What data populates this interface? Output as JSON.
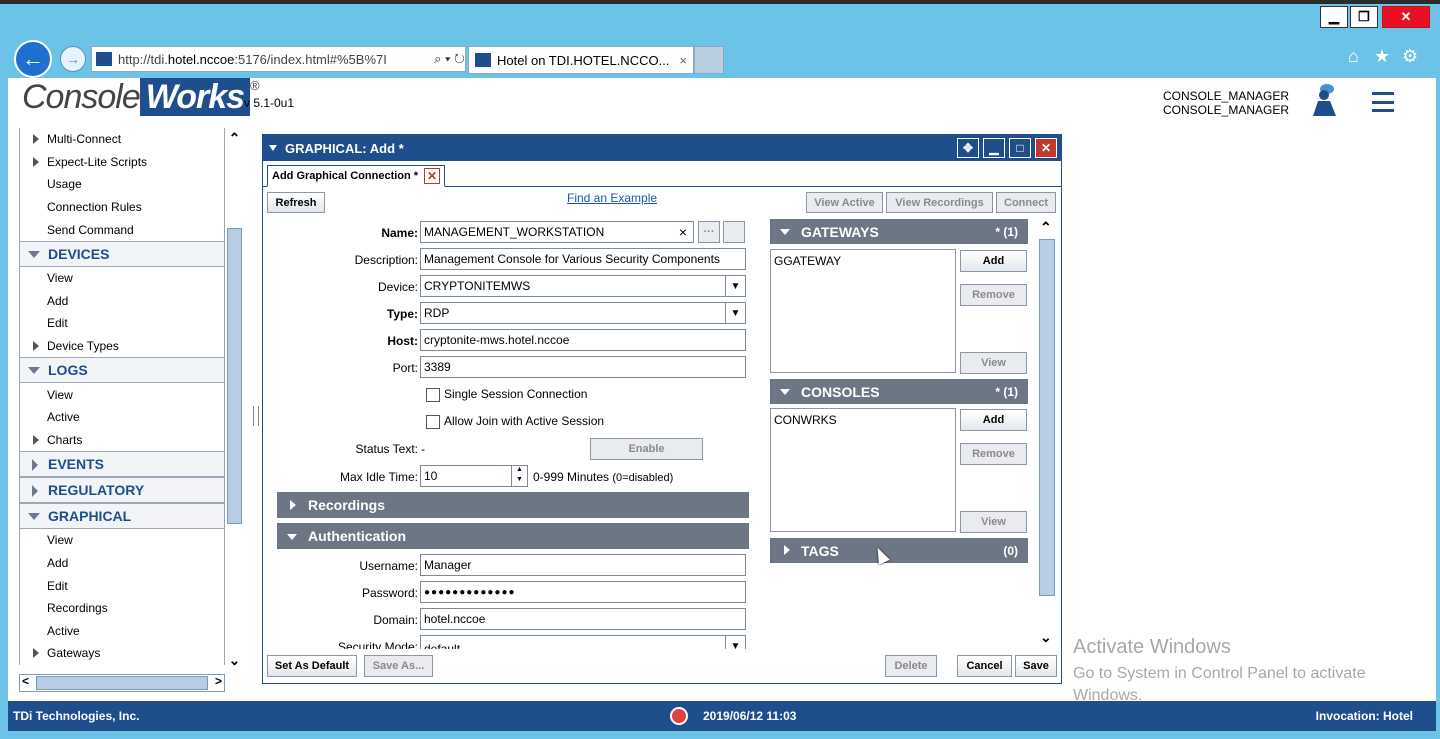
{
  "browser": {
    "url_pre": "http://tdi.",
    "url_host": "hotel.nccoe",
    "url_post": ":5176/index.html#%5B%7I",
    "url_controls": "⌕ ▾ ↻",
    "tab_title": "Hotel on TDI.HOTEL.NCCO...",
    "tab_close": "×",
    "min": "▁",
    "max": "❐",
    "close": "✕",
    "back": "←",
    "forward": "→",
    "home": "⌂",
    "star": "★",
    "gear": "⚙"
  },
  "app": {
    "logo_a": "Console",
    "logo_b": "Works",
    "logo_reg": "®",
    "version": "v 5.1-0u1",
    "user_line1": "CONSOLE_MANAGER",
    "user_line2": "CONSOLE_MANAGER"
  },
  "sidebar": {
    "top_items": [
      {
        "label": "Multi-Connect",
        "sub": true
      },
      {
        "label": "Expect-Lite Scripts",
        "sub": true
      },
      {
        "label": "Usage",
        "sub": false
      },
      {
        "label": "Connection Rules",
        "sub": false
      },
      {
        "label": "Send Command",
        "sub": false
      }
    ],
    "devices": {
      "title": "DEVICES",
      "items": [
        "View",
        "Add",
        "Edit"
      ],
      "sub_item": "Device Types"
    },
    "logs": {
      "title": "LOGS",
      "items": [
        "View",
        "Active"
      ],
      "sub_item": "Charts"
    },
    "events": "EVENTS",
    "regulatory": "REGULATORY",
    "graphical": {
      "title": "GRAPHICAL",
      "items": [
        "View",
        "Add",
        "Edit",
        "Recordings",
        "Active"
      ],
      "sub_item": "Gateways"
    },
    "scroll_up": "⌃",
    "scroll_down": "⌄",
    "hscroll_left": "<",
    "hscroll_right": ">"
  },
  "dialog": {
    "title": "GRAPHICAL: Add *",
    "ctl_move": "✥",
    "ctl_min": "▁",
    "ctl_max": "□",
    "ctl_close": "✕",
    "tab_label": "Add Graphical Connection *",
    "tab_close": "✕",
    "refresh": "Refresh",
    "find_example": "Find an Example",
    "view_active": "View Active",
    "view_recordings": "View Recordings",
    "connect": "Connect",
    "form": {
      "name_label": "Name:",
      "name_value": "MANAGEMENT_WORKSTATION",
      "name_clear": "×",
      "name_more": "···",
      "desc_label": "Description:",
      "desc_value": "Management Console for Various Security Components",
      "device_label": "Device:",
      "device_value": "CRYPTONITEMWS",
      "type_label": "Type:",
      "type_value": "RDP",
      "host_label": "Host:",
      "host_value": "cryptonite-mws.hotel.nccoe",
      "port_label": "Port:",
      "port_value": "3389",
      "single_session": "Single Session Connection",
      "allow_join": "Allow Join with Active Session",
      "status_label": "Status Text:",
      "status_value": "-",
      "enable": "Enable",
      "idle_label": "Max Idle Time:",
      "idle_value": "10",
      "idle_units": "0-999 Minutes",
      "idle_note": "(0=disabled)",
      "dropdown": "▼",
      "spin_up": "▲",
      "spin_down": "▼"
    },
    "recordings": "Recordings",
    "authentication": "Authentication",
    "auth": {
      "user_label": "Username:",
      "user_value": "Manager",
      "pass_label": "Password:",
      "pass_value": "●●●●●●●●●●●●●",
      "domain_label": "Domain:",
      "domain_value": "hotel.nccoe",
      "secmode_label": "Security Mode:",
      "secmode_value": "default"
    },
    "gateways": {
      "title": "GATEWAYS",
      "count": "* (1)",
      "items": [
        "GGATEWAY"
      ],
      "add": "Add",
      "remove": "Remove",
      "view": "View"
    },
    "consoles": {
      "title": "CONSOLES",
      "count": "* (1)",
      "items": [
        "CONWRKS"
      ],
      "add": "Add",
      "remove": "Remove",
      "view": "View"
    },
    "tags": {
      "title": "TAGS",
      "count": "(0)"
    },
    "scroll_up": "⌃",
    "scroll_down": "⌄",
    "set_default": "Set As Default",
    "save_as": "Save As...",
    "delete": "Delete",
    "cancel": "Cancel",
    "save": "Save"
  },
  "watermark": {
    "line1": "Activate Windows",
    "line2": "Go to System in Control Panel to activate",
    "line3": "Windows."
  },
  "statusbar": {
    "company": "TDi Technologies, Inc.",
    "datetime": "2019/06/12 11:03",
    "invocation": "Invocation:  Hotel"
  }
}
